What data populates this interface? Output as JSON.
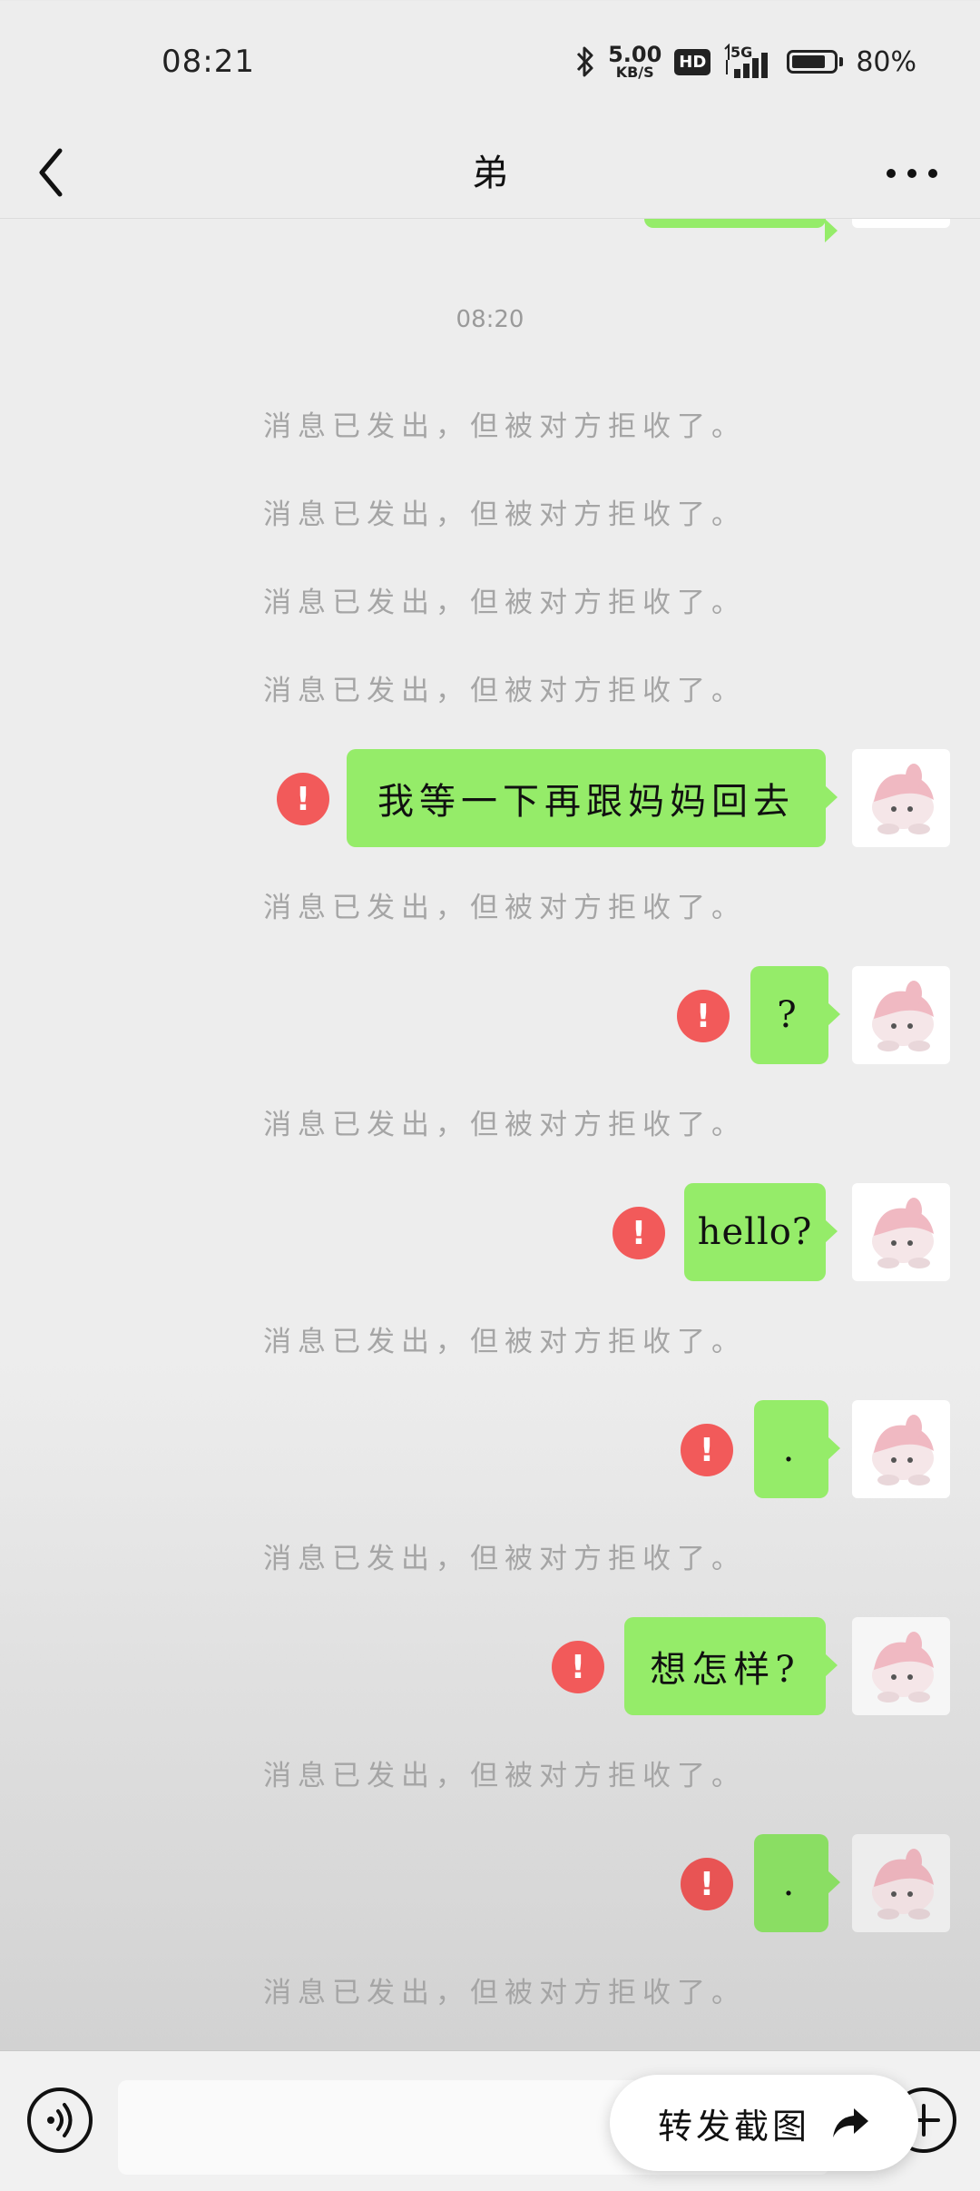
{
  "status_bar": {
    "time": "08:21",
    "net_speed": "5.00",
    "net_speed_unit": "KB/S",
    "hd": "HD",
    "network": "5G",
    "battery": "80%",
    "battery_level": 0.8
  },
  "header": {
    "title": "弟",
    "back_icon": "chevron-left-icon",
    "more_icon": "more-dots-icon"
  },
  "chat": {
    "timestamp": "08:20",
    "system_text": "消息已发出，但被对方拒收了。",
    "messages": [
      {
        "text": "我等一下再跟妈妈回去",
        "status": "failed"
      },
      {
        "text": "?",
        "status": "failed"
      },
      {
        "text": "hello?",
        "status": "failed"
      },
      {
        "text": ".",
        "status": "failed"
      },
      {
        "text": "想怎样?",
        "status": "failed"
      },
      {
        "text": ".",
        "status": "failed"
      }
    ],
    "error_mark": "!"
  },
  "input_bar": {
    "voice_icon": "voice-icon",
    "plus_icon": "plus-icon",
    "share_label": "转发截图",
    "share_icon": "share-arrow-icon"
  },
  "colors": {
    "bubble": "#95ec69",
    "error": "#f25a5a",
    "background": "#ededed"
  }
}
